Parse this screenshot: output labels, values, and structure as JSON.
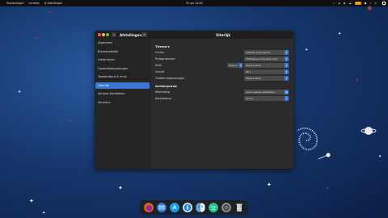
{
  "topbar": {
    "activities": "Toepassingen",
    "places": "Locaties",
    "app_name": "Afstellingen",
    "clock": "30 apr 24:09",
    "badge": "10"
  },
  "window": {
    "app_title": "Afstellingen",
    "page_title": "Uiterlijk",
    "search_icon": "search-icon",
    "menu_icon": "hamburger-menu-icon"
  },
  "sidebar": {
    "items": [
      {
        "label": "Algemeen"
      },
      {
        "label": "Bovenbalkstijl"
      },
      {
        "label": "Lettertypen"
      },
      {
        "label": "Opstarttoepassingen"
      },
      {
        "label": "Toetsenbord & muis"
      },
      {
        "label": "Uiterlijk"
      },
      {
        "label": "Venster-titelbalken"
      },
      {
        "label": "Vensters"
      }
    ],
    "active_index": 5
  },
  "main": {
    "themes_title": "Thema's",
    "cursor_label": "Cursor",
    "cursor_value": "Adwaita (standaard)",
    "icons_label": "Pictogrammen",
    "icons_value": "McMojave-circle-blue-dark",
    "shell_label": "Shell",
    "shell_button": "Mojave",
    "shell_value": "Mojave-Dark",
    "sound_label": "Geluid",
    "sound_value": "Yaru",
    "legacy_label": "Oudere toepassingen",
    "legacy_value": "Mojave-Dark",
    "background_title": "Achtergrond",
    "image_label": "Afbeelding",
    "image_value": "green-galaxy-wallpaper...",
    "adjust_label": "Aanpassing",
    "adjust_value": "Zoom"
  },
  "dock": {
    "icons": [
      "firefox-icon",
      "mail-icon",
      "store-icon",
      "safari-icon",
      "finder-icon",
      "spotify-icon",
      "settings-icon",
      "trash-icon"
    ]
  },
  "colors": {
    "accent": "#3a76d0",
    "window_bg": "#2b2b2b",
    "sidebar_bg": "#242424",
    "badge": "#e08a00"
  }
}
